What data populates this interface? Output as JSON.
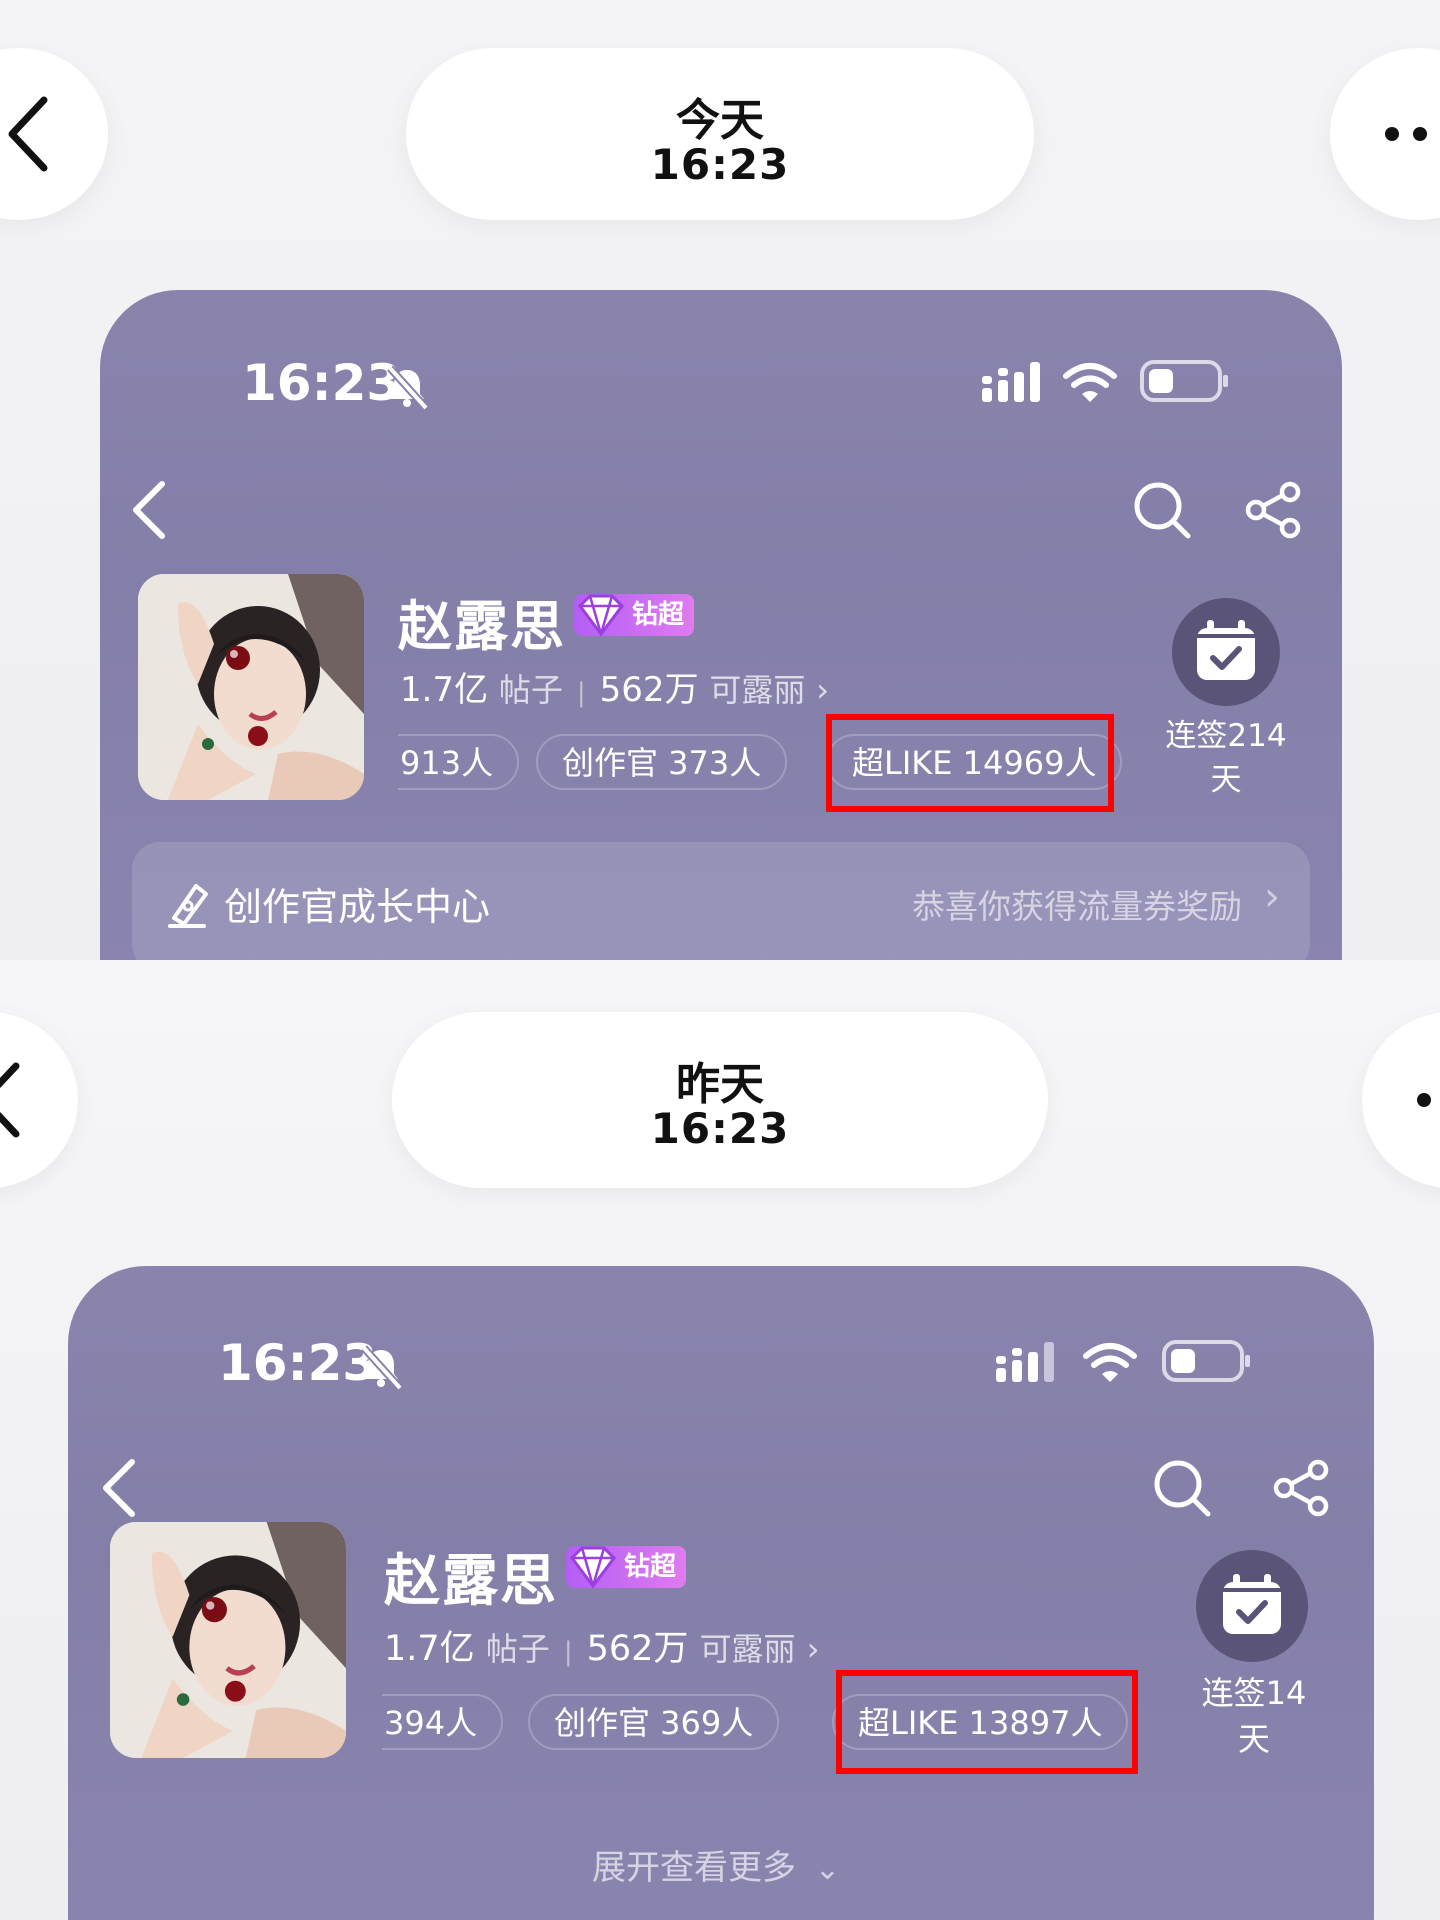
{
  "today": {
    "day_label": "今天",
    "time": "16:23",
    "status_time": "16:23",
    "name": "赵露思",
    "badge": "钻超",
    "posts_count": "1.7亿",
    "posts_label": "帖子",
    "fans_count": "562万",
    "fans_label": "可露丽",
    "chips": [
      "913人",
      "创作官 373人",
      "超LIKE 14969人"
    ],
    "checkin": "连签214\n天",
    "growth_title": "创作官成长中心",
    "growth_link": "恭喜你获得流量券奖励"
  },
  "yesterday": {
    "day_label": "昨天",
    "time": "16:23",
    "status_time": "16:23",
    "name": "赵露思",
    "badge": "钻超",
    "posts_count": "1.7亿",
    "posts_label": "帖子",
    "fans_count": "562万",
    "fans_label": "可露丽",
    "chips": [
      "394人",
      "创作官 369人",
      "超LIKE 13897人"
    ],
    "checkin": "连签14\n天",
    "expand_more": "展开查看更多"
  },
  "colors": {
    "card": "#8782ab",
    "highlight": "#ff0000",
    "badge": "#c66cf2"
  },
  "icons": [
    "back-icon",
    "more-icon",
    "bell-off-icon",
    "signal-icon",
    "wifi-icon",
    "battery-icon",
    "search-icon",
    "share-icon",
    "diamond-icon",
    "calendar-check-icon",
    "pen-icon",
    "chevron-right-icon",
    "chevron-down-icon"
  ]
}
